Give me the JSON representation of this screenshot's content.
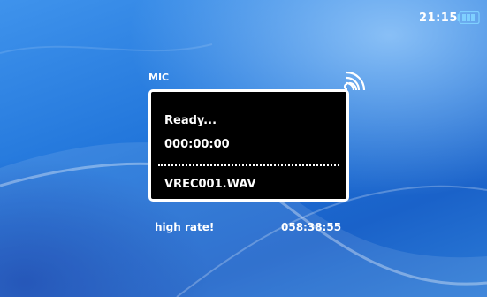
{
  "status_bar": {
    "time": "21:15",
    "battery_icon": "battery-icon"
  },
  "recorder": {
    "source_label": "MIC",
    "signal_icon": "signal-waves-icon",
    "status": "Ready...",
    "elapsed": "000:00:00",
    "filename": "VREC001.WAV",
    "quality": "high rate!",
    "remaining": "058:38:55"
  },
  "colors": {
    "background": "#1f73d9",
    "panel": "#000000",
    "text": "#ffffff"
  }
}
